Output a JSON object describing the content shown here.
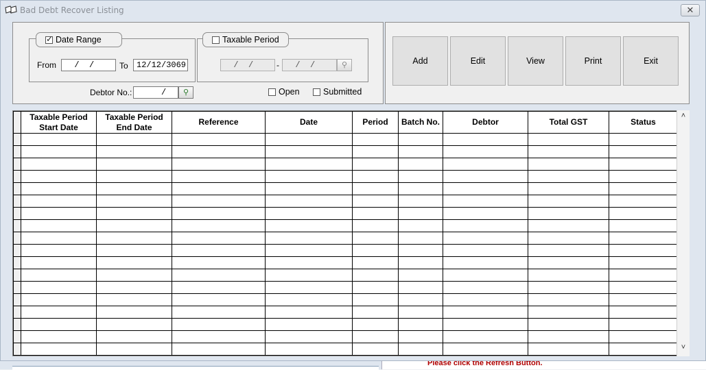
{
  "window": {
    "title": "Bad Debt Recover Listing",
    "close_glyph": "✕"
  },
  "filters": {
    "date_range": {
      "label": "Date Range",
      "checked": true,
      "from_label": "From",
      "from_value": "  /  /    ",
      "to_label": "To",
      "to_value": "12/12/3069"
    },
    "taxable_period": {
      "label": "Taxable Period",
      "checked": false,
      "start_value": "  /  /  ",
      "separator": "-",
      "end_value": "  /  /  "
    },
    "debtor": {
      "label": "Debtor No.:",
      "value": "     /"
    },
    "open": {
      "label": "Open",
      "checked": false
    },
    "submitted": {
      "label": "Submitted",
      "checked": false
    }
  },
  "actions": {
    "add": "Add",
    "edit": "Edit",
    "view": "View",
    "print": "Print",
    "exit": "Exit"
  },
  "grid": {
    "columns": [
      {
        "line1": "Taxable Period",
        "line2": "Start Date"
      },
      {
        "line1": "Taxable Period",
        "line2": "End Date"
      },
      {
        "line1": "Reference",
        "line2": ""
      },
      {
        "line1": "Date",
        "line2": ""
      },
      {
        "line1": "Period",
        "line2": ""
      },
      {
        "line1": "Batch No.",
        "line2": ""
      },
      {
        "line1": "Debtor",
        "line2": ""
      },
      {
        "line1": "Total GST",
        "line2": ""
      },
      {
        "line1": "Status",
        "line2": ""
      }
    ],
    "row_count": 18
  },
  "footer": {
    "hint": "Please click the Refresh Button."
  },
  "icons": {
    "app": "book-icon",
    "lookup": "magnifier-icon",
    "scroll_up": "chevron-up-icon",
    "scroll_down": "chevron-down-icon"
  }
}
